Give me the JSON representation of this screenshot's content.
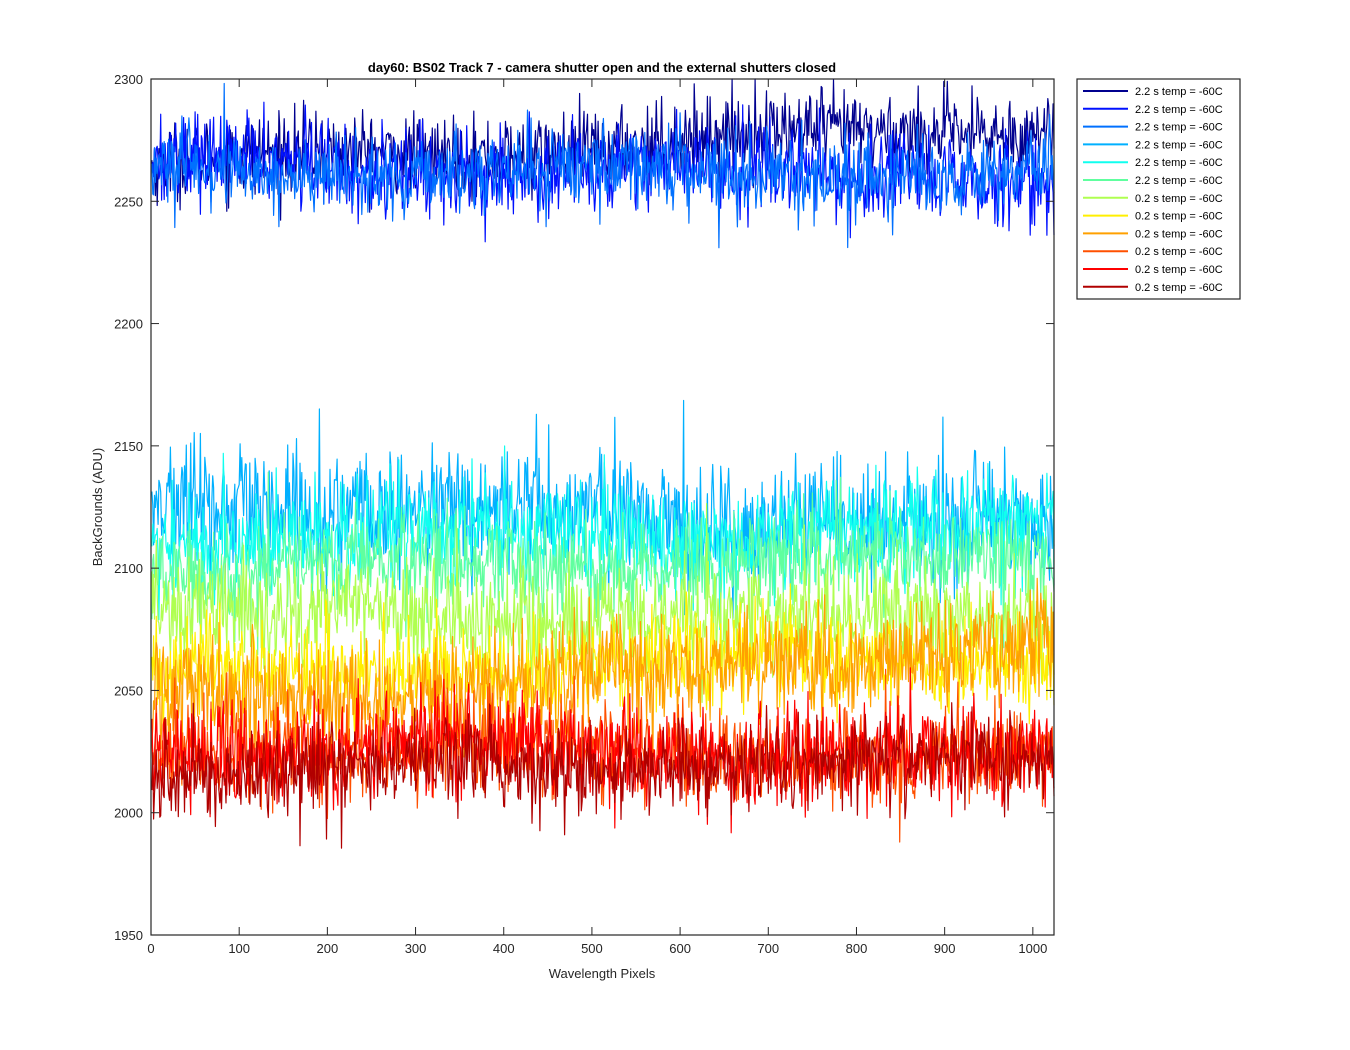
{
  "chart_data": {
    "type": "line",
    "title": "day60: BS02  Track 7 - camera shutter open and the external shutters closed",
    "xlabel": "Wavelength Pixels",
    "ylabel": "BackGrounds (ADU)",
    "xlim": [
      0,
      1024
    ],
    "ylim": [
      1950,
      2300
    ],
    "xticks": [
      0,
      100,
      200,
      300,
      400,
      500,
      600,
      700,
      800,
      900,
      1000
    ],
    "yticks": [
      1950,
      2000,
      2050,
      2100,
      2150,
      2200,
      2250,
      2300
    ],
    "grid": false,
    "legend_position": "outside-top-right",
    "series": [
      {
        "name": "2.2 s temp = -60C",
        "color": "#00008f",
        "mean": 2271,
        "noise": 8,
        "ramp": [
          -6,
          10
        ]
      },
      {
        "name": "2.2 s temp = -60C",
        "color": "#0010ff",
        "mean": 2264,
        "noise": 9,
        "ramp": [
          2,
          -4
        ]
      },
      {
        "name": "2.2 s temp = -60C",
        "color": "#0070ff",
        "mean": 2262,
        "noise": 8,
        "ramp": [
          0,
          0
        ]
      },
      {
        "name": "2.2 s temp = -60C",
        "color": "#00b0ff",
        "mean": 2122,
        "noise": 13,
        "ramp": [
          4,
          -6
        ]
      },
      {
        "name": "2.2 s temp = -60C",
        "color": "#10ffef",
        "mean": 2112,
        "noise": 11,
        "ramp": [
          0,
          4
        ]
      },
      {
        "name": "2.2 s temp = -60C",
        "color": "#60ff9f",
        "mean": 2101,
        "noise": 10,
        "ramp": [
          -2,
          4
        ]
      },
      {
        "name": "0.2 s temp = -60C",
        "color": "#afff50",
        "mean": 2084,
        "noise": 11,
        "ramp": [
          -3,
          -4
        ]
      },
      {
        "name": "0.2 s temp = -60C",
        "color": "#ffef00",
        "mean": 2055,
        "noise": 10,
        "ramp": [
          0,
          10
        ]
      },
      {
        "name": "0.2 s temp = -60C",
        "color": "#ffa000",
        "mean": 2050,
        "noise": 11,
        "ramp": [
          -6,
          18
        ]
      },
      {
        "name": "0.2 s temp = -60C",
        "color": "#ff5000",
        "mean": 2028,
        "noise": 10,
        "ramp": [
          0,
          -6
        ]
      },
      {
        "name": "0.2 s temp = -60C",
        "color": "#ff0000",
        "mean": 2027,
        "noise": 10,
        "ramp": [
          0,
          -4
        ]
      },
      {
        "name": "0.2 s temp = -60C",
        "color": "#b00000",
        "mean": 2017,
        "noise": 9,
        "ramp": [
          0,
          4
        ]
      }
    ]
  }
}
